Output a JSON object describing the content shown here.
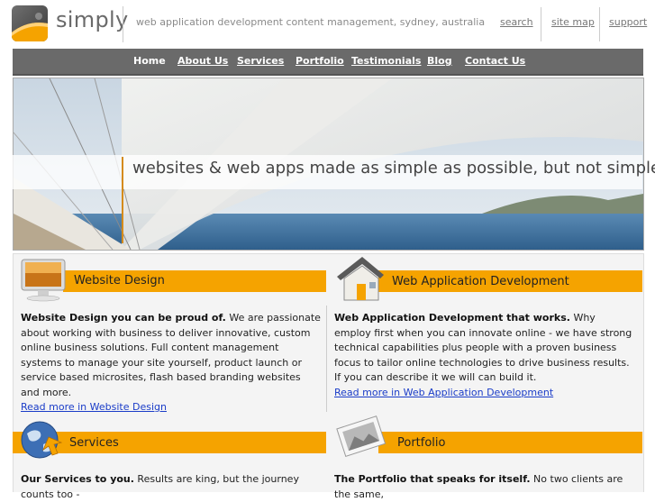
{
  "header": {
    "logo_text": "simply",
    "tagline": "web application development content management, sydney, australia",
    "utility_links": [
      "search",
      "site map",
      "support"
    ]
  },
  "nav": {
    "items": [
      "Home",
      "About Us",
      "Services",
      "Portfolio",
      "Testimonials",
      "Blog",
      "Contact Us"
    ]
  },
  "hero": {
    "caption": "websites & web apps made as simple as possible, but not simpler"
  },
  "sections": {
    "website_design": {
      "title": "Website Design",
      "lead": "Website Design you can be proud of.",
      "body": " We are passionate about working with business to deliver innovative, custom online business solutions. Full content management systems to manage your site yourself, product launch or service based microsites, flash based branding websites and more.",
      "link": "Read more in Website Design"
    },
    "web_app": {
      "title": "Web Application Development",
      "lead": "Web Application Development that works.",
      "body": " Why employ first when you can innovate online - we have strong technical capabilities plus people with a proven business focus to tailor online technologies to drive business results. If you can describe it we will can build it.",
      "link": "Read more in Web Application Development"
    },
    "services": {
      "title": "Services",
      "lead": "Our Services to you.",
      "body": " Results are king, but the journey counts too -"
    },
    "portfolio": {
      "title": "Portfolio",
      "lead": "The Portfolio that speaks for itself.",
      "body": " No two clients are the same,"
    }
  },
  "colors": {
    "accent": "#f5a300",
    "nav_bg": "#6a6a6a",
    "link": "#1a3cc8"
  }
}
